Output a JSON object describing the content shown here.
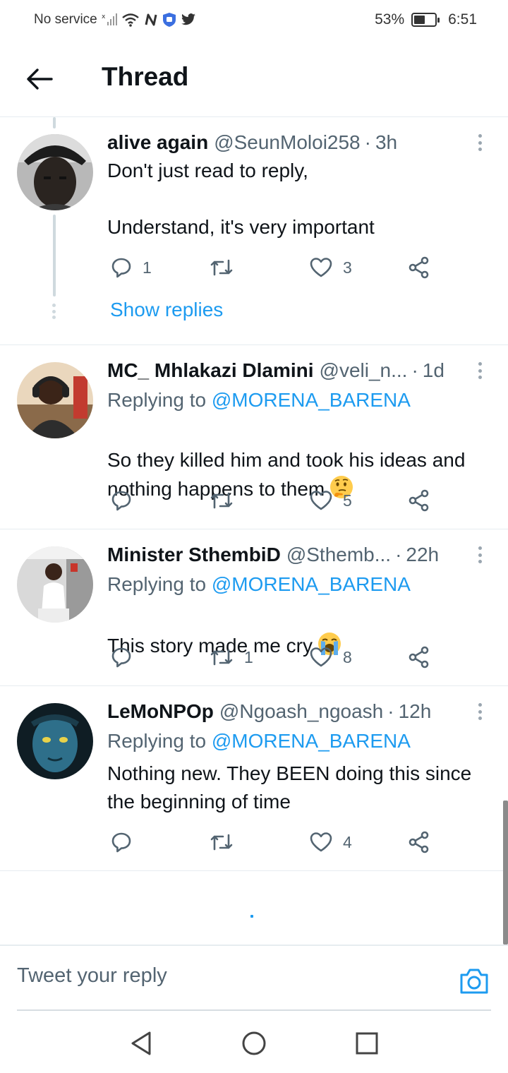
{
  "status_bar": {
    "carrier": "No service",
    "battery": "53%",
    "battery_level": 0.53,
    "time": "6:51"
  },
  "header": {
    "title": "Thread"
  },
  "tweets": [
    {
      "name": "alive again",
      "handle": "@SeunMoloi258",
      "time": "3h",
      "reply_prefix": "",
      "reply_to": "",
      "text": "Don't just read to reply,\n\nUnderstand, it's very important",
      "replies": "1",
      "retweets": "",
      "likes": "3",
      "show_replies": "Show replies"
    },
    {
      "name": "MC_ Mhlakazi Dlamini",
      "handle": "@veli_n...",
      "time": "1d",
      "reply_prefix": "Replying to",
      "reply_to": "@MORENA_BARENA",
      "text": "So they killed him and took his ideas and nothing happens to them",
      "emoji": "thinking-face",
      "replies": "",
      "retweets": "",
      "likes": "5"
    },
    {
      "name": "Minister SthembiD",
      "handle": "@Sthemb...",
      "time": "22h",
      "reply_prefix": "Replying to",
      "reply_to": "@MORENA_BARENA",
      "text": "This story made me cry",
      "emoji": "loudly-crying-face",
      "replies": "",
      "retweets": "1",
      "likes": "8"
    },
    {
      "name": "LeMoNPOp",
      "handle": "@Ngoash_ngoash",
      "time": "12h",
      "reply_prefix": "Replying to",
      "reply_to": "@MORENA_BARENA",
      "text": "Nothing new. They BEEN doing this since the beginning of time",
      "replies": "",
      "retweets": "",
      "likes": "4"
    }
  ],
  "composer": {
    "placeholder": "Tweet your reply"
  },
  "colors": {
    "accent": "#1d9bf0",
    "text": "#0f1419",
    "secondary": "#536471",
    "divider": "#e6ecf0"
  }
}
